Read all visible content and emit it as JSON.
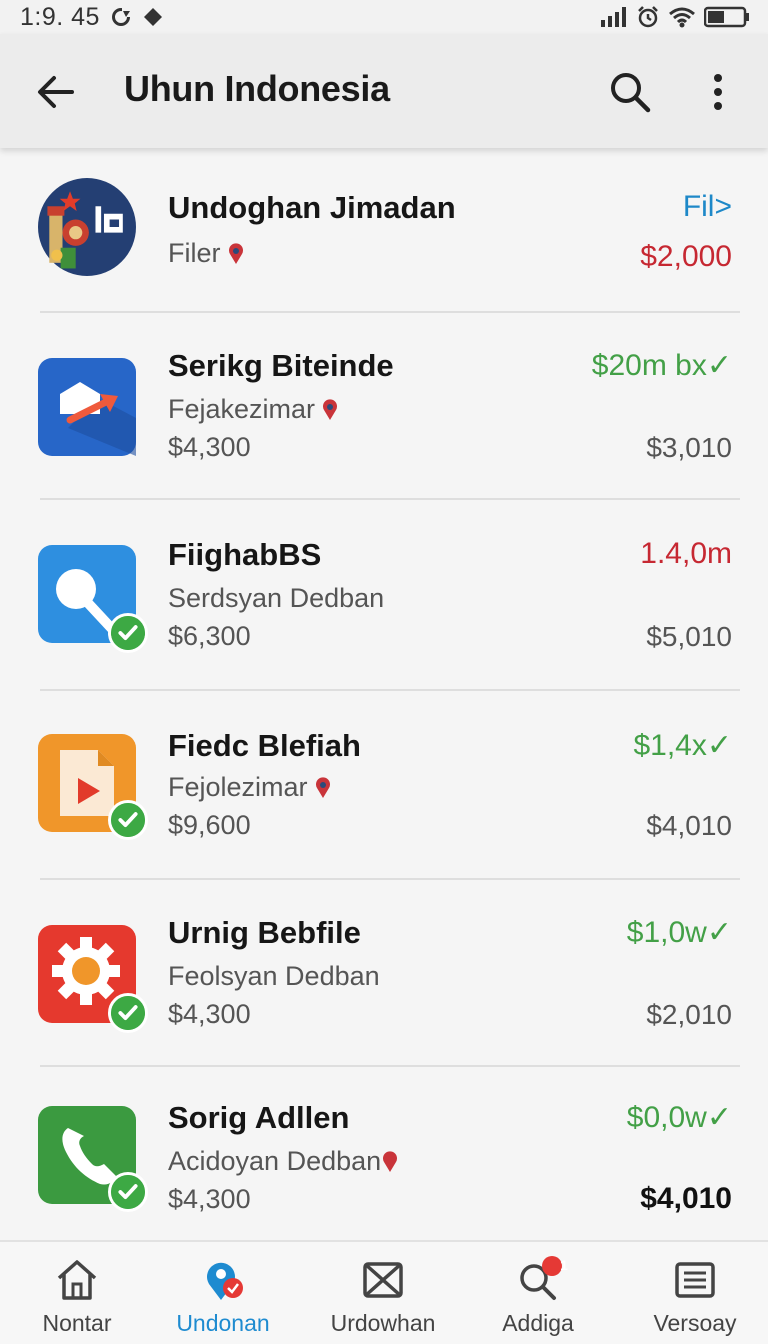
{
  "status_bar": {
    "time": "1:9. 45",
    "icons": [
      "sync-icon",
      "navigation-icon",
      "signal-icon",
      "alarm-icon",
      "wifi-icon",
      "battery-icon"
    ]
  },
  "app_bar": {
    "title": "Uhun Indonesia",
    "icons": [
      "back-arrow-icon",
      "search-icon",
      "more-vert-icon"
    ]
  },
  "items": [
    {
      "icon": "indonesia-emblem-icon",
      "title": "Undoghan Jimadan",
      "subtitle": "Filer",
      "price": "",
      "right_top": "Fil>",
      "right_top_color": "#1e88c8",
      "right_bottom": "$2,000",
      "right_bottom_color": "#c62832",
      "verified": false,
      "pin": true
    },
    {
      "icon": "share-box-icon",
      "title": "Serikg Biteinde",
      "subtitle": "Fejakezimar",
      "price": "$4,300",
      "right_top": "$20m bx✓",
      "right_top_color": "#43a047",
      "right_bottom": "$3,010",
      "right_bottom_color": "#555555",
      "verified": false,
      "pin": true
    },
    {
      "icon": "magnifier-icon",
      "title": "FiighabBS",
      "subtitle": "Serdsyan Dedban",
      "price": "$6,300",
      "right_top": "1.4,0m",
      "right_top_color": "#c62832",
      "right_bottom": "$5,010",
      "right_bottom_color": "#555555",
      "verified": true,
      "pin": false
    },
    {
      "icon": "video-file-icon",
      "title": "Fiedc Blefiah",
      "subtitle": "Fejolezimar",
      "price": "$9,600",
      "right_top": "$1,4x✓",
      "right_top_color": "#43a047",
      "right_bottom": "$4,010",
      "right_bottom_color": "#555555",
      "verified": true,
      "pin": true
    },
    {
      "icon": "gear-icon",
      "title": "Urnig Bebfile",
      "subtitle": "Feolsyan Dedban",
      "price": "$4,300",
      "right_top": "$1,0w✓",
      "right_top_color": "#43a047",
      "right_bottom": "$2,010",
      "right_bottom_color": "#555555",
      "verified": true,
      "pin": false
    },
    {
      "icon": "phone-icon",
      "title": "Sorig Adllen",
      "subtitle": "Acidoyan Dedban",
      "price": "$4,300",
      "right_top": "$0,0w✓",
      "right_top_color": "#43a047",
      "right_bottom": "$4,010",
      "right_bottom_color": "#111111",
      "verified": true,
      "pin": true
    }
  ],
  "bottom_nav": [
    {
      "label": "Nontar",
      "icon": "home-icon",
      "active": false
    },
    {
      "label": "Undonan",
      "icon": "location-chat-icon",
      "active": true
    },
    {
      "label": "Urdowhan",
      "icon": "mail-box-icon",
      "active": false
    },
    {
      "label": "Addiga",
      "icon": "search-badge-icon",
      "active": false,
      "badge": "1"
    },
    {
      "label": "Versoay",
      "icon": "list-icon",
      "active": false
    }
  ],
  "colors": {
    "accent_blue": "#1e8bd0",
    "price_green": "#43a047",
    "price_red": "#c62832",
    "check_green": "#3da944"
  }
}
